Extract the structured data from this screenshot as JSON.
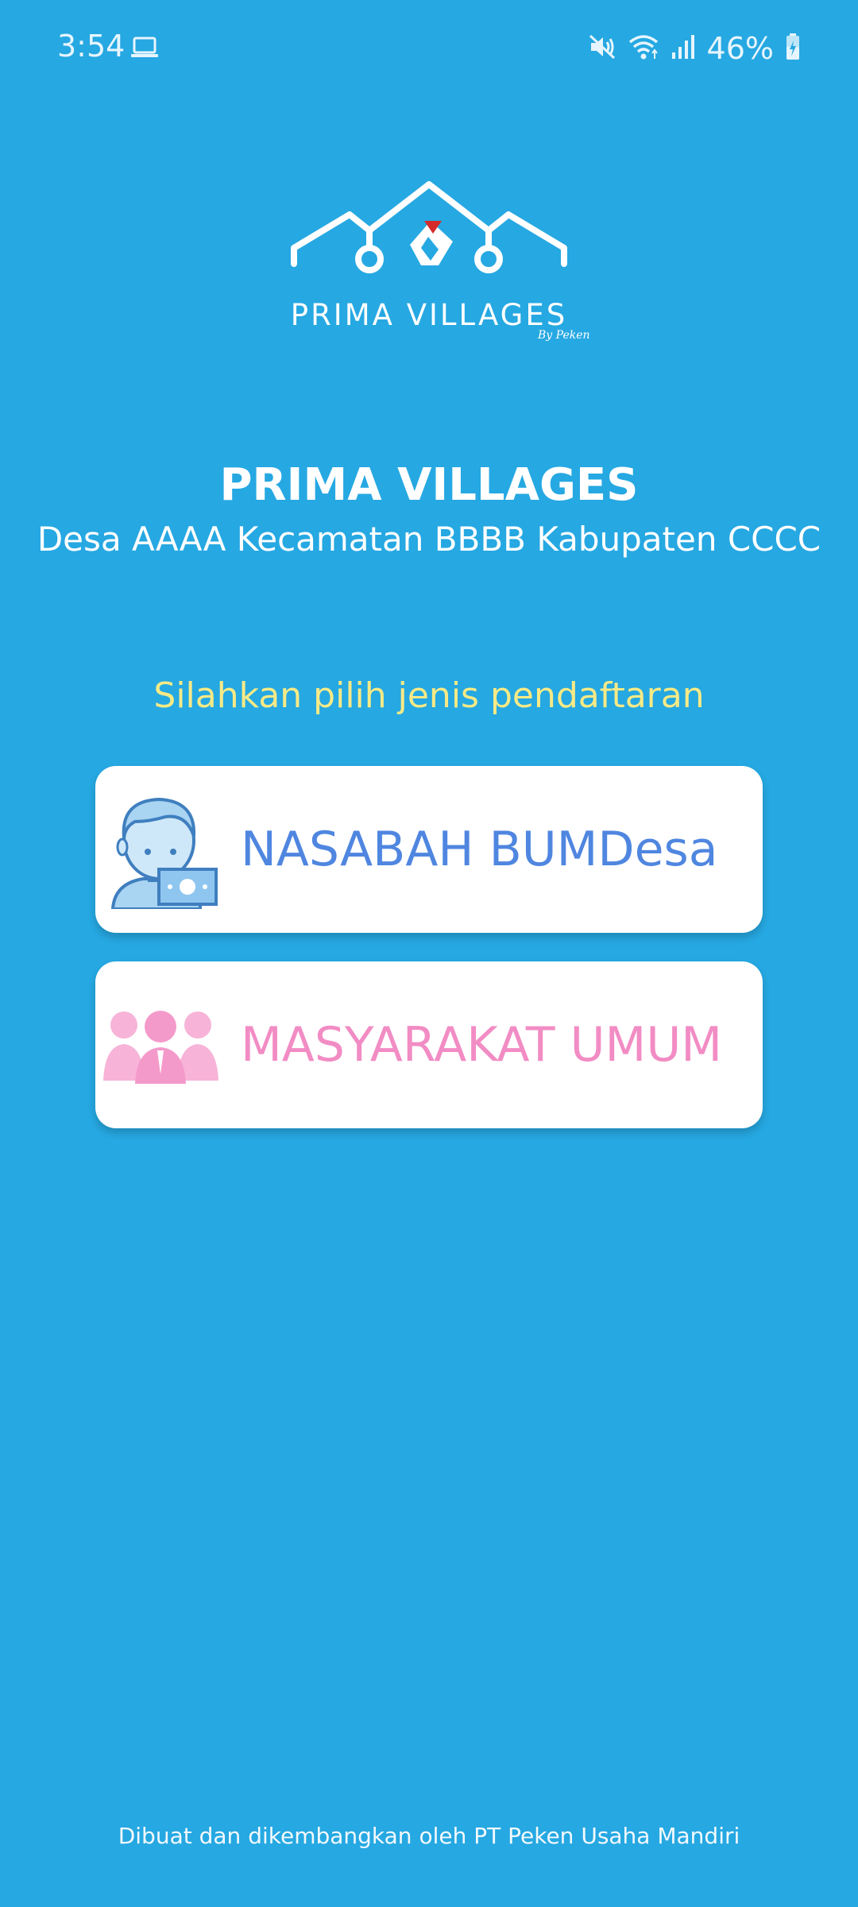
{
  "status_bar": {
    "time": "3:54",
    "battery": "46%",
    "icons": [
      "laptop-icon",
      "mute-icon",
      "wifi-icon",
      "signal-icon",
      "battery-icon"
    ]
  },
  "logo": {
    "word": "PRIMA VILLAGES",
    "by": "By Peken"
  },
  "header": {
    "title": "PRIMA VILLAGES",
    "subtitle": "Desa AAAA Kecamatan BBBB Kabupaten CCCC"
  },
  "prompt": "Silahkan pilih jenis pendaftaran",
  "options": [
    {
      "label": "NASABAH BUMDesa",
      "icon": "customer-money-icon",
      "color": "#4f86e0"
    },
    {
      "label": "MASYARAKAT UMUM",
      "icon": "people-group-icon",
      "color": "#f28cc4"
    }
  ],
  "footer": "Dibuat dan dikembangkan oleh PT Peken Usaha Mandiri",
  "colors": {
    "background": "#26a8e2",
    "prompt": "#f7ea86",
    "card": "#ffffff"
  }
}
